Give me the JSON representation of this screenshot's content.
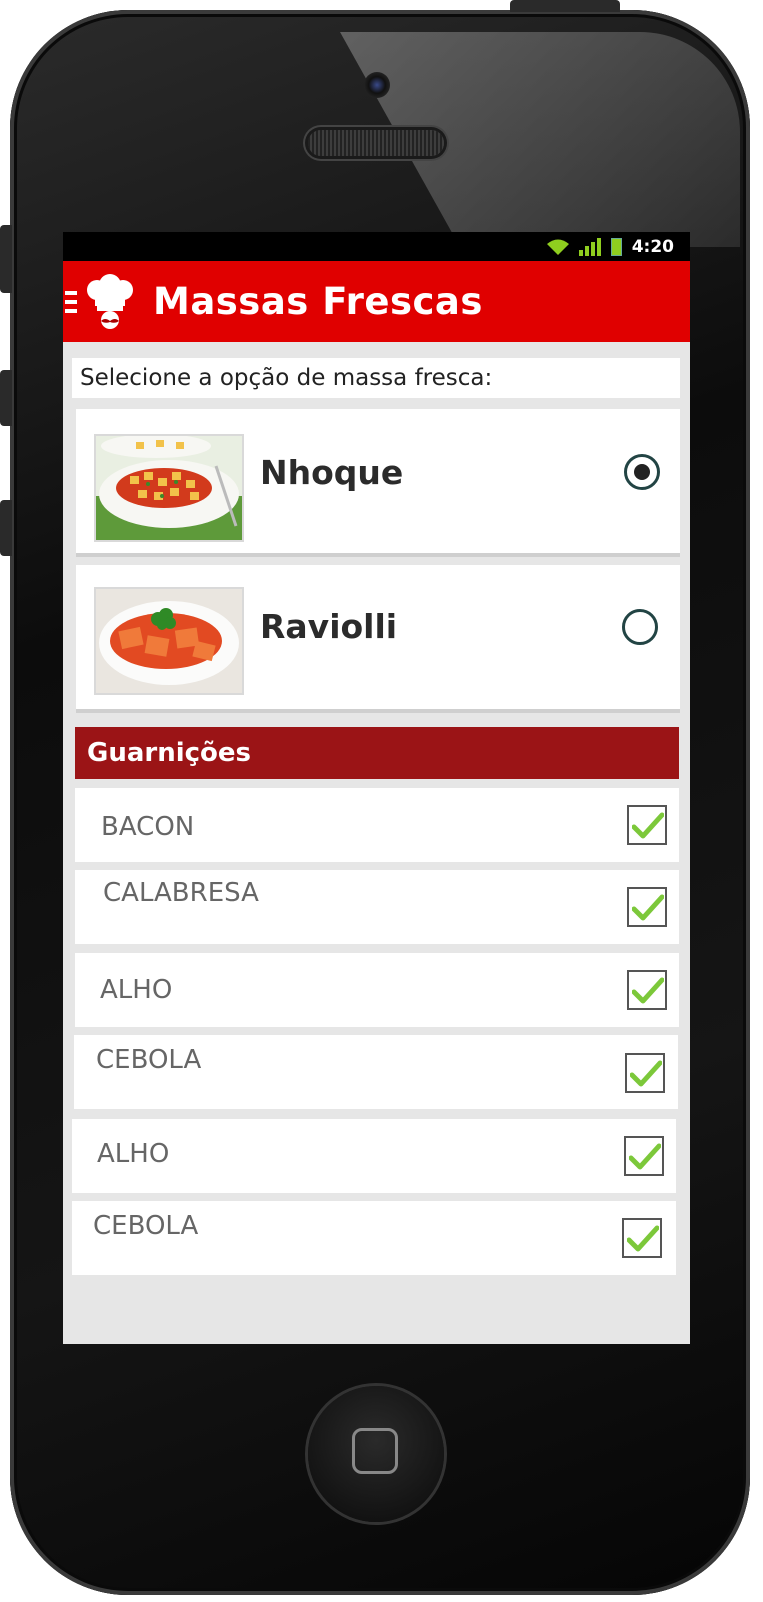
{
  "status_bar": {
    "time": "4:20"
  },
  "app_bar": {
    "title": "Massas Frescas",
    "menu_icon": "menu-icon",
    "logo_icon": "chef-hat-icon"
  },
  "prompt": "Selecione a opção de massa fresca:",
  "pasta_options": [
    {
      "name": "Nhoque",
      "selected": true
    },
    {
      "name": "Raviolli",
      "selected": false
    }
  ],
  "section": {
    "title": "Guarnições"
  },
  "garnishes": [
    {
      "label": "BACON",
      "checked": true
    },
    {
      "label": "CALABRESA",
      "checked": true
    },
    {
      "label": "ALHO",
      "checked": true
    },
    {
      "label": "CEBOLA",
      "checked": true
    },
    {
      "label": "ALHO",
      "checked": true
    },
    {
      "label": "CEBOLA",
      "checked": true
    }
  ],
  "colors": {
    "app_bar": "#e00000",
    "section_header": "#9b1416",
    "check": "#7cc83a"
  }
}
